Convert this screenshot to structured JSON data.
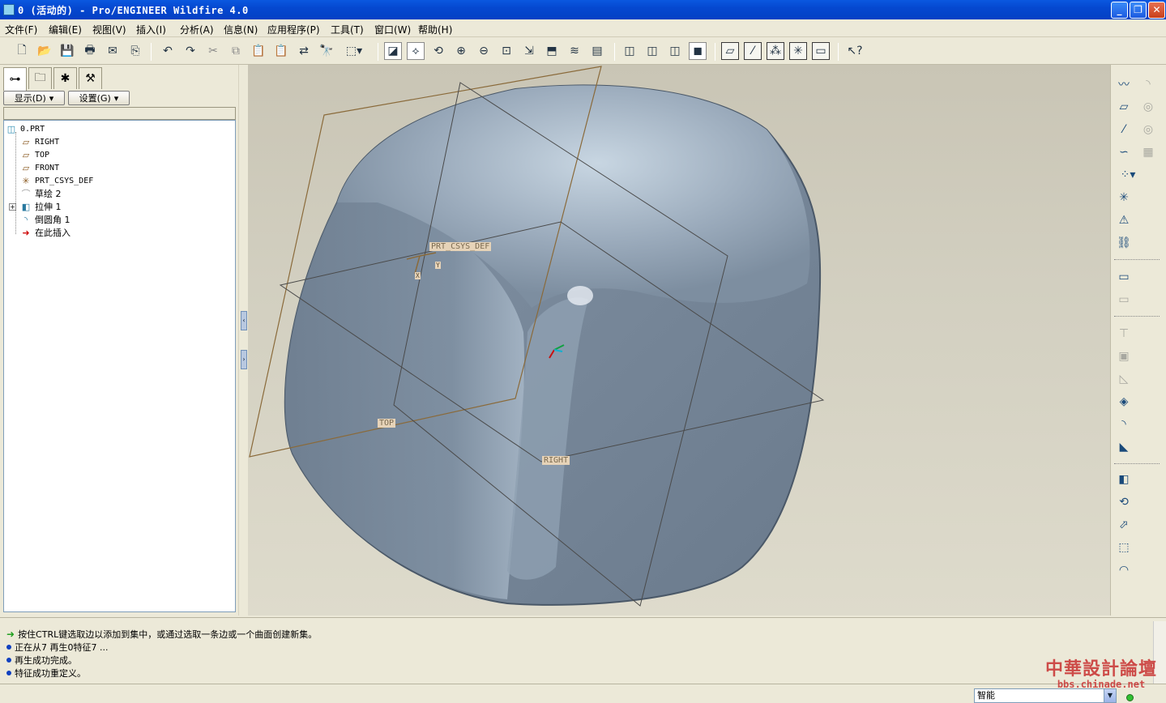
{
  "window": {
    "title": "0 (活动的) - Pro/ENGINEER Wildfire 4.0",
    "minimize": "_",
    "maximize": "❐",
    "close": "✕"
  },
  "menubar": {
    "items": [
      "文件(F)",
      "编辑(E)",
      "视图(V)",
      "插入(I)",
      "分析(A)",
      "信息(N)",
      "应用程序(P)",
      "工具(T)",
      "窗口(W)",
      "帮助(H)"
    ]
  },
  "left_panel": {
    "show_button": "显示(D)",
    "settings_button": "设置(G)",
    "tree": {
      "root": "0.PRT",
      "items": [
        "RIGHT",
        "TOP",
        "FRONT",
        "PRT_CSYS_DEF",
        "草绘 2",
        "拉伸 1",
        "倒圆角 1",
        "在此插入"
      ]
    }
  },
  "graphics": {
    "csys_label": "PRT_CSYS_DEF",
    "top_label": "TOP",
    "right_label": "RIGHT",
    "axis_x": "X",
    "axis_y": "Y",
    "axis_z": "Z"
  },
  "messages": [
    "按住CTRL键选取边以添加到集中，或通过选取一条边或一个曲面创建新集。",
    "正在从7 再生0特征7 ...",
    "再生成功完成。",
    "特征成功重定义。"
  ],
  "status": {
    "filter_value": "智能"
  },
  "watermark": {
    "name": "中華設計論壇",
    "url": "bbs.chinade.net"
  },
  "colors": {
    "titlebar": "#0548d0",
    "model_surface": "#7d8ea0",
    "datum_plane": "#8a6a3a",
    "datum_tag_bg": "#e6d3b8"
  }
}
